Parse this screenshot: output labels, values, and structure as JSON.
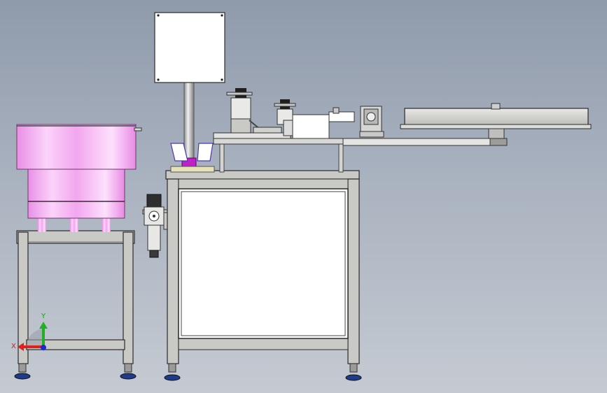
{
  "viewport": {
    "background_top": "#8f9aab",
    "background_bottom": "#c5cad2",
    "metal_color": "#c9cac6",
    "edge_color": "#2b2b2b",
    "bowl_color": "#f2a6ee",
    "shaft_accent": "#c020c8",
    "filter_bowl_color": "#3a3a3a",
    "foot_color": "#1e3a8a"
  },
  "triad": {
    "x_label": "X",
    "y_label": "Y",
    "x_color": "#e02020",
    "y_color": "#20b020",
    "z_color": "#1a2ad0"
  }
}
